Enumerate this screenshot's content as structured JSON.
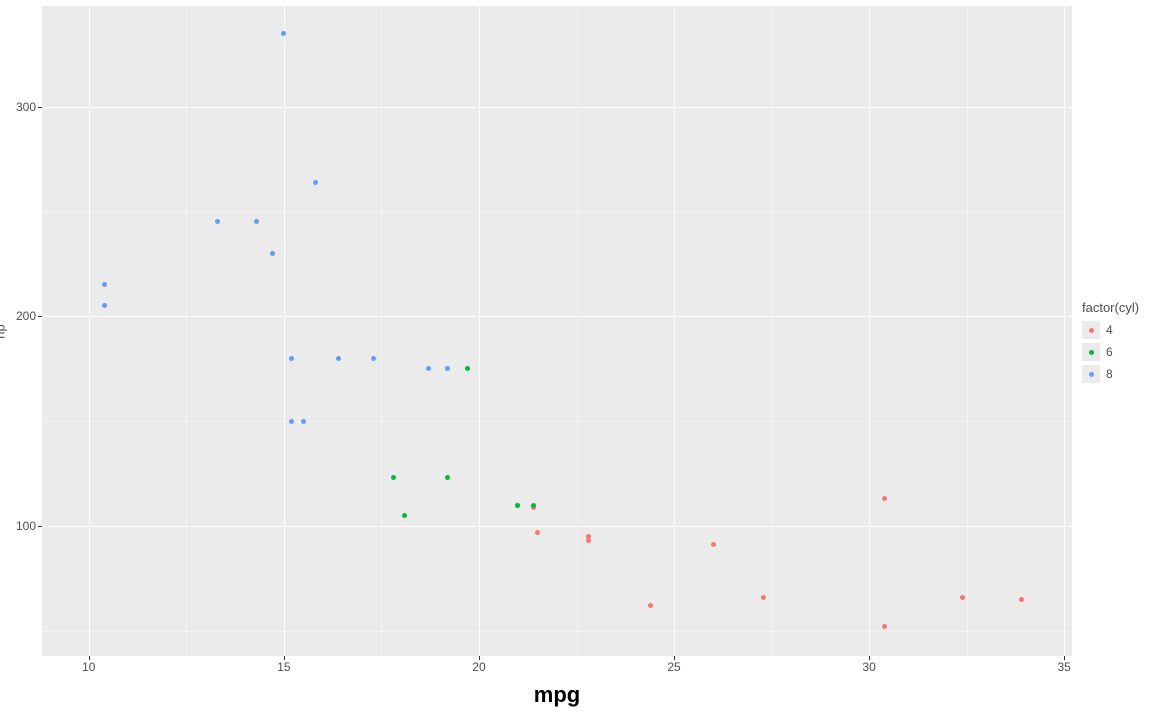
{
  "chart_data": {
    "type": "scatter",
    "xlabel": "mpg",
    "ylabel": "hp",
    "xlim": [
      8.8,
      35.2
    ],
    "ylim": [
      38,
      348
    ],
    "x_ticks": [
      10,
      15,
      20,
      25,
      30,
      35
    ],
    "y_ticks": [
      100,
      200,
      300
    ],
    "x_minor": [
      12.5,
      17.5,
      22.5,
      27.5,
      32.5
    ],
    "y_minor": [
      50,
      150,
      250
    ],
    "legend_title": "factor(cyl)",
    "series": [
      {
        "name": "4",
        "color": "#f8766d",
        "points": [
          {
            "x": 22.8,
            "y": 93
          },
          {
            "x": 24.4,
            "y": 62
          },
          {
            "x": 22.8,
            "y": 95
          },
          {
            "x": 32.4,
            "y": 66
          },
          {
            "x": 30.4,
            "y": 52
          },
          {
            "x": 33.9,
            "y": 65
          },
          {
            "x": 21.5,
            "y": 97
          },
          {
            "x": 27.3,
            "y": 66
          },
          {
            "x": 26.0,
            "y": 91
          },
          {
            "x": 30.4,
            "y": 113
          },
          {
            "x": 21.4,
            "y": 109
          }
        ]
      },
      {
        "name": "6",
        "color": "#00ba38",
        "points": [
          {
            "x": 21.0,
            "y": 110
          },
          {
            "x": 21.0,
            "y": 110
          },
          {
            "x": 21.4,
            "y": 110
          },
          {
            "x": 18.1,
            "y": 105
          },
          {
            "x": 19.2,
            "y": 123
          },
          {
            "x": 17.8,
            "y": 123
          },
          {
            "x": 19.7,
            "y": 175
          }
        ]
      },
      {
        "name": "8",
        "color": "#619cff",
        "points": [
          {
            "x": 18.7,
            "y": 175
          },
          {
            "x": 14.3,
            "y": 245
          },
          {
            "x": 16.4,
            "y": 180
          },
          {
            "x": 17.3,
            "y": 180
          },
          {
            "x": 15.2,
            "y": 180
          },
          {
            "x": 10.4,
            "y": 205
          },
          {
            "x": 10.4,
            "y": 215
          },
          {
            "x": 14.7,
            "y": 230
          },
          {
            "x": 15.5,
            "y": 150
          },
          {
            "x": 15.2,
            "y": 150
          },
          {
            "x": 13.3,
            "y": 245
          },
          {
            "x": 19.2,
            "y": 175
          },
          {
            "x": 15.8,
            "y": 264
          },
          {
            "x": 15.0,
            "y": 335
          }
        ]
      }
    ]
  }
}
